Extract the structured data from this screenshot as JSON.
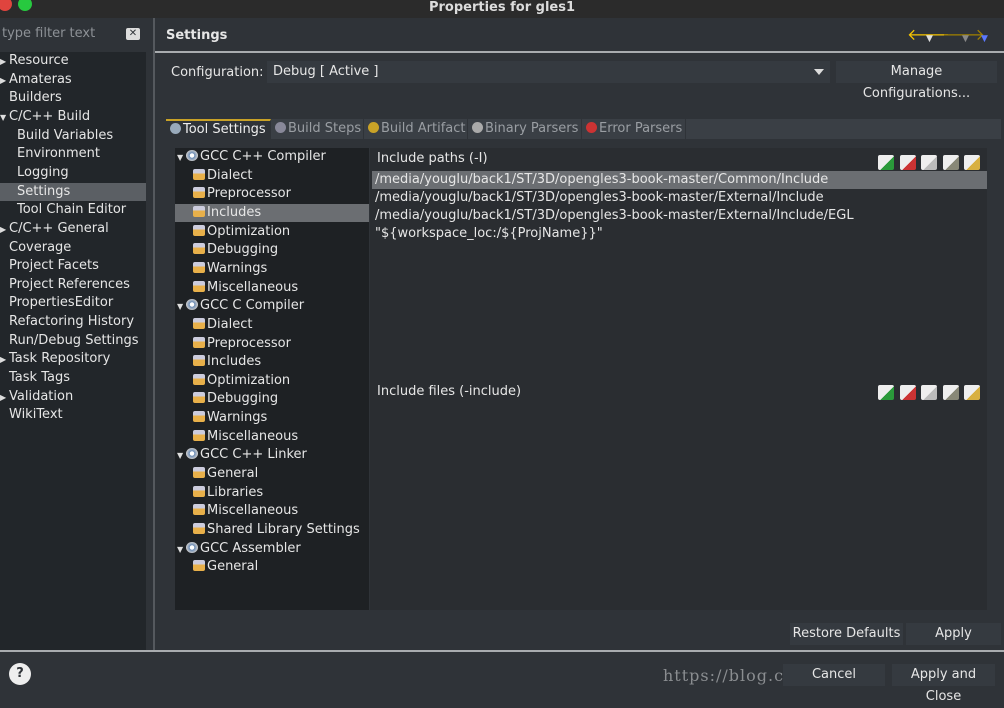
{
  "window": {
    "title": "Properties for gles1"
  },
  "left": {
    "filter_placeholder": "type filter text",
    "items": [
      {
        "label": "Resource",
        "level": 0,
        "expandable": true
      },
      {
        "label": "Amateras",
        "level": 0,
        "expandable": true
      },
      {
        "label": "Builders",
        "level": 0
      },
      {
        "label": "C/C++ Build",
        "level": 0,
        "expanded": true
      },
      {
        "label": "Build Variables",
        "level": 1
      },
      {
        "label": "Environment",
        "level": 1
      },
      {
        "label": "Logging",
        "level": 1
      },
      {
        "label": "Settings",
        "level": 1,
        "selected": true
      },
      {
        "label": "Tool Chain Editor",
        "level": 1
      },
      {
        "label": "C/C++ General",
        "level": 0,
        "expandable": true
      },
      {
        "label": "Coverage",
        "level": 0
      },
      {
        "label": "Project Facets",
        "level": 0
      },
      {
        "label": "Project References",
        "level": 0
      },
      {
        "label": "PropertiesEditor",
        "level": 0
      },
      {
        "label": "Refactoring History",
        "level": 0
      },
      {
        "label": "Run/Debug Settings",
        "level": 0
      },
      {
        "label": "Task Repository",
        "level": 0,
        "expandable": true
      },
      {
        "label": "Task Tags",
        "level": 0
      },
      {
        "label": "Validation",
        "level": 0,
        "expandable": true
      },
      {
        "label": "WikiText",
        "level": 0
      }
    ]
  },
  "header": {
    "title": "Settings"
  },
  "config": {
    "label": "Configuration:",
    "value": "Debug  [ Active ]",
    "manage": "Manage Configurations..."
  },
  "tabs": [
    {
      "label": "Tool Settings",
      "active": true
    },
    {
      "label": "Build Steps"
    },
    {
      "label": "Build Artifact"
    },
    {
      "label": "Binary Parsers"
    },
    {
      "label": "Error Parsers"
    }
  ],
  "tree": [
    {
      "label": "GCC C++ Compiler",
      "type": "tool"
    },
    {
      "label": "Dialect",
      "type": "option"
    },
    {
      "label": "Preprocessor",
      "type": "option"
    },
    {
      "label": "Includes",
      "type": "option",
      "selected": true
    },
    {
      "label": "Optimization",
      "type": "option"
    },
    {
      "label": "Debugging",
      "type": "option"
    },
    {
      "label": "Warnings",
      "type": "option"
    },
    {
      "label": "Miscellaneous",
      "type": "option"
    },
    {
      "label": "GCC C Compiler",
      "type": "tool"
    },
    {
      "label": "Dialect",
      "type": "option"
    },
    {
      "label": "Preprocessor",
      "type": "option"
    },
    {
      "label": "Includes",
      "type": "option"
    },
    {
      "label": "Optimization",
      "type": "option"
    },
    {
      "label": "Debugging",
      "type": "option"
    },
    {
      "label": "Warnings",
      "type": "option"
    },
    {
      "label": "Miscellaneous",
      "type": "option"
    },
    {
      "label": "GCC C++ Linker",
      "type": "tool"
    },
    {
      "label": "General",
      "type": "option"
    },
    {
      "label": "Libraries",
      "type": "option"
    },
    {
      "label": "Miscellaneous",
      "type": "option"
    },
    {
      "label": "Shared Library Settings",
      "type": "option"
    },
    {
      "label": "GCC Assembler",
      "type": "tool"
    },
    {
      "label": "General",
      "type": "option"
    }
  ],
  "include_paths": {
    "label": "Include paths (-I)",
    "items": [
      "/media/youglu/back1/ST/3D/opengles3-book-master/Common/Include",
      "/media/youglu/back1/ST/3D/opengles3-book-master/External/Include",
      "/media/youglu/back1/ST/3D/opengles3-book-master/External/Include/EGL",
      "\"${workspace_loc:/${ProjName}}\""
    ]
  },
  "include_files": {
    "label": "Include files (-include)",
    "items": []
  },
  "toolbar_icons": [
    "add-icon",
    "delete-icon",
    "edit-icon",
    "move-up-icon",
    "move-down-icon"
  ],
  "buttons": {
    "restore": "Restore Defaults",
    "apply": "Apply",
    "cancel": "Cancel",
    "apply_close": "Apply and Close",
    "help": "?"
  },
  "watermark": "https://blog.csdn.net/c",
  "colors": {
    "selection": "#6b6e72",
    "tab_accent": "#c9a227",
    "back_arrow": "#f5c400",
    "forward_arrow": "#a08000",
    "menu_arrow": "#5a78ff"
  }
}
